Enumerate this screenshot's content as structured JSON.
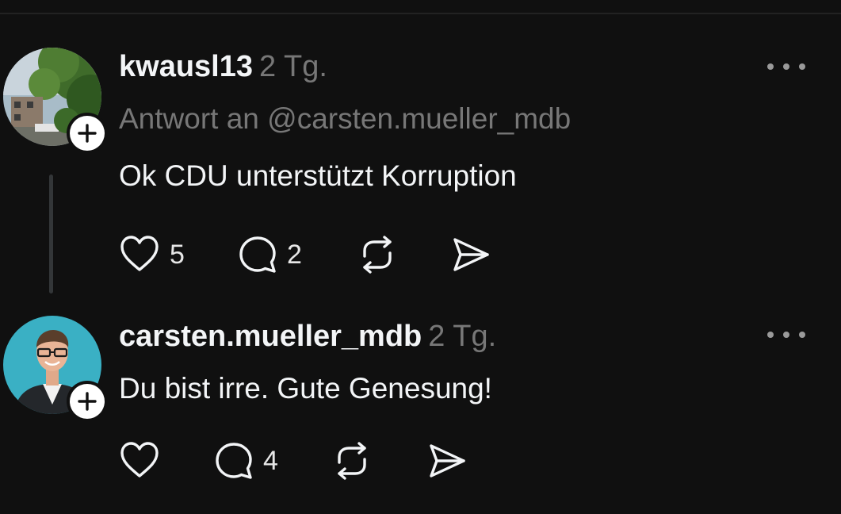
{
  "posts": [
    {
      "username": "kwausl13",
      "time": "2 Tg.",
      "reply_to": "Antwort an @carsten.mueller_mdb",
      "text": "Ok CDU unterstützt Korruption",
      "likes": "5",
      "replies": "2"
    },
    {
      "username": "carsten.mueller_mdb",
      "time": "2 Tg.",
      "text": "Du bist irre. Gute Genesung!",
      "likes": "",
      "replies": "4"
    }
  ],
  "icons": {
    "like": "heart-icon",
    "reply": "comment-icon",
    "repost": "repost-icon",
    "share": "send-icon",
    "more": "more-icon",
    "follow": "plus-icon"
  },
  "colors": {
    "background": "#101010",
    "primary_text": "#f3f5f7",
    "secondary_text": "#777777",
    "thread_line": "#333638"
  }
}
